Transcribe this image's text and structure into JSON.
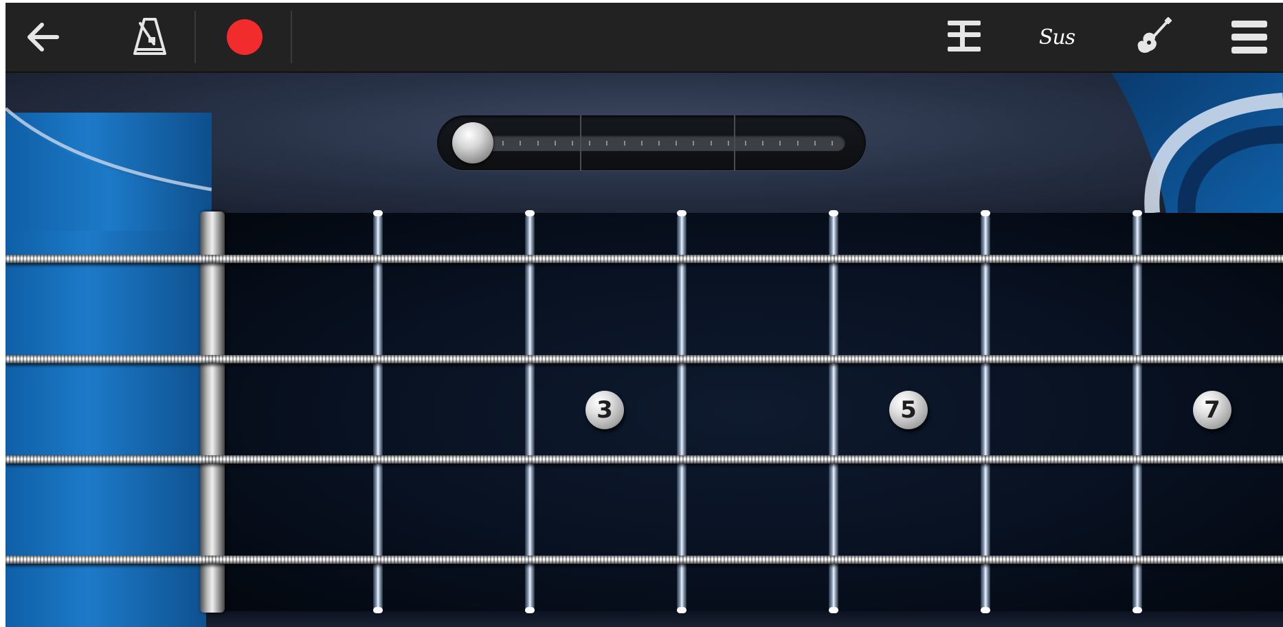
{
  "toolbar": {
    "back_icon": "arrow-left-icon",
    "metronome_icon": "metronome-icon",
    "record_icon": "record-icon",
    "record_color": "#f22c2c",
    "chord_mode_icon": "chord-mode-icon",
    "sustain_label": "Sus",
    "guitar_icon": "guitar-icon",
    "menu_icon": "hamburger-menu-icon"
  },
  "slider": {
    "position_fraction": 0.0
  },
  "fretboard": {
    "string_count": 4,
    "visible_frets": 6,
    "inlays": [
      {
        "label": "3"
      },
      {
        "label": "5"
      },
      {
        "label": "7"
      }
    ]
  },
  "colors": {
    "toolbar_bg": "#222222",
    "body_blue": "#1d7ac8",
    "fretboard_bg": "#081121"
  }
}
